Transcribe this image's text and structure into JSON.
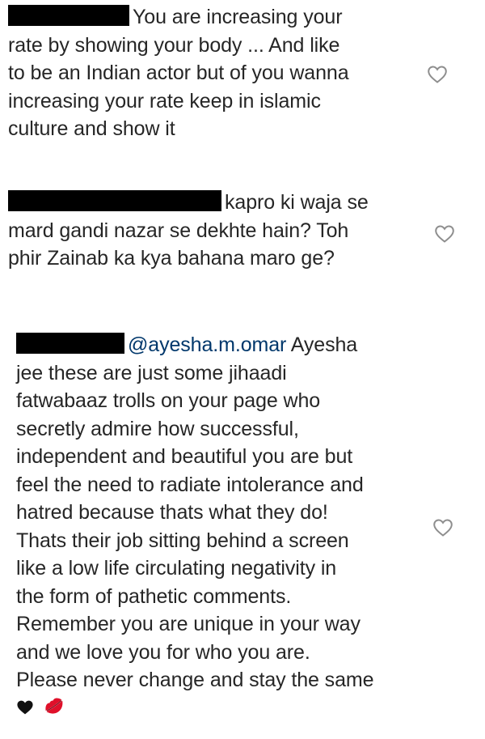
{
  "comments": [
    {
      "lines": [
        "You are increasing your",
        "rate by showing your body ... And like",
        "to be an Indian actor but of you wanna",
        "increasing your rate keep in islamic",
        "culture and show it"
      ],
      "like_icon": "heart-outline-icon"
    },
    {
      "lines": [
        "kapro ki waja se",
        "mard gandi nazar se dekhte hain? Toh",
        "phir Zainab ka kya bahana maro ge?"
      ],
      "like_icon": "heart-outline-icon"
    },
    {
      "mention": "@ayesha.m.omar",
      "lines": [
        "Ayesha",
        "jee these are just some jihaadi",
        "fatwabaaz trolls on your page who",
        "secretly admire how successful,",
        "independent and beautiful you are but",
        "feel the need to radiate intolerance and",
        "hatred because thats what they do!",
        "Thats their job sitting behind a screen",
        "like a low life circulating negativity in",
        "the form of pathetic comments.",
        "Remember you are unique in your way",
        "and we love you for who you are.",
        "Please never change and stay the same"
      ],
      "emojis": [
        "black-heart-icon",
        "kiss-mark-icon"
      ],
      "like_icon": "heart-outline-icon"
    }
  ],
  "colors": {
    "text": "#262626",
    "mention": "#00376b",
    "redaction": "#000000",
    "heart_outline": "#8e8e8e"
  }
}
